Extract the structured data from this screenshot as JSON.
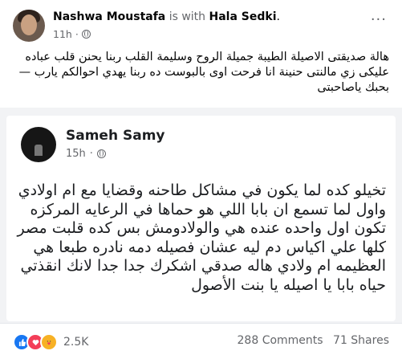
{
  "post": {
    "author": "Nashwa Moustafa",
    "with_text": "is with",
    "tagged": "Hala Sedki",
    "tagged_suffix": ".",
    "time": "11h",
    "time_sep": "·",
    "more_label": "···",
    "caption": "هالة صديقتى الاصيلة الطيبة جميلة الروح وسليمة القلب ربنا يحنن قلب عباده عليكى زي مالنتى حنينة انا فرحت اوى بالبوست ده ربنا يهدي احوالكم يارب — بحبك ياصاحبتى"
  },
  "shared": {
    "author": "Sameh Samy",
    "time": "15h",
    "time_sep": "·",
    "body_lines": [
      "تخيلو كده لما يكون في مشاكل طاحنه وقضايا مع ام اولادي",
      "واول لما تسمع ان بابا اللي هو حماها في الرعايه المركزه",
      "تكون اول واحده عنده هي والولادومش بس كده قلبت مصر",
      "كلها علي اكياس دم ليه عشان فصيله دمه نادره طبعا هي",
      "العظيمه ام ولادي هاله صدقي اشكرك جدا جدا لانك انقذتي",
      "حياه بابا يا اصيله يا بنت الأصول"
    ]
  },
  "footer": {
    "reaction_count": "2.5K",
    "comments": "288 Comments",
    "shares": "71 Shares",
    "reaction_icons": [
      "like-icon",
      "love-icon",
      "care-icon"
    ]
  },
  "colors": {
    "like": "#1877f2",
    "love": "#f33e58",
    "care": "#f7b125",
    "secondary_text": "#65676b"
  }
}
